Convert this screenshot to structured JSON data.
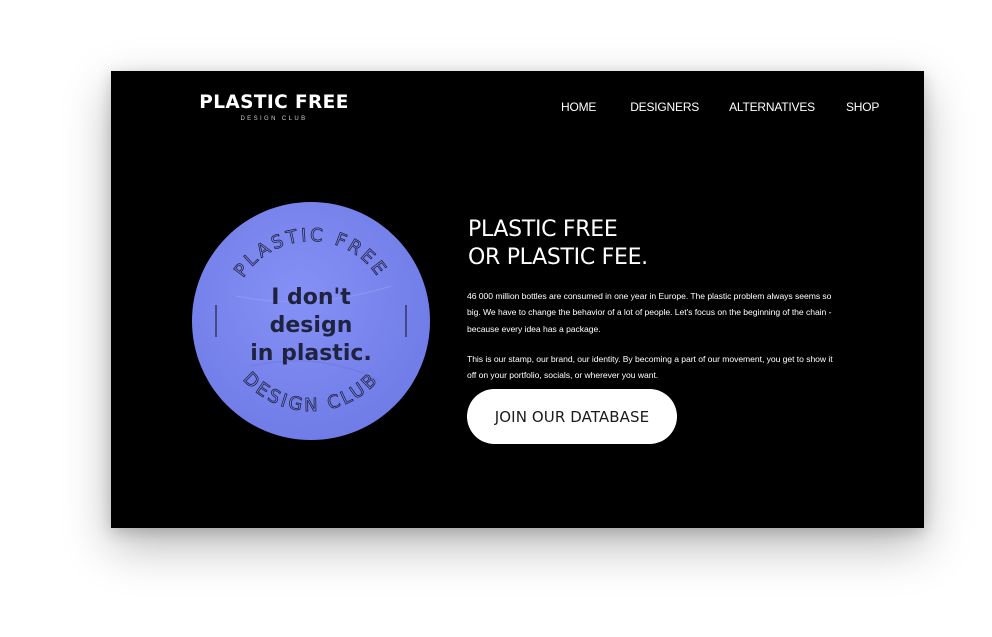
{
  "brand": {
    "name": "PLASTIC FREE",
    "tagline": "DESIGN CLUB"
  },
  "nav": {
    "items": [
      {
        "label": "HOME"
      },
      {
        "label": "DESIGNERS"
      },
      {
        "label": "ALTERNATIVES"
      },
      {
        "label": "SHOP"
      }
    ]
  },
  "stamp": {
    "top_arc": "PLASTIC FREE",
    "bottom_arc": "DESIGN CLUB",
    "line1": "I don't",
    "line2": "design",
    "line3": "in plastic.",
    "color": "#7b87ef",
    "text_color": "#1f2340"
  },
  "hero": {
    "headline_line1": "PLASTIC FREE",
    "headline_line2": "OR PLASTIC FEE.",
    "paragraph1": "46 000 million bottles are consumed in one year in Europe. The plastic problem always seems so big. We have to change the behavior of a lot of people. Let's focus on the beginning of the chain - because every idea has a package.",
    "paragraph2": "This is our stamp, our brand, our identity. By becoming a part of our movement, you get to show it off on your portfolio, socials, or wherever you want.",
    "cta_label": "JOIN OUR DATABASE"
  },
  "colors": {
    "background": "#000000",
    "accent": "#7b87ef",
    "button": "#ffffff"
  }
}
